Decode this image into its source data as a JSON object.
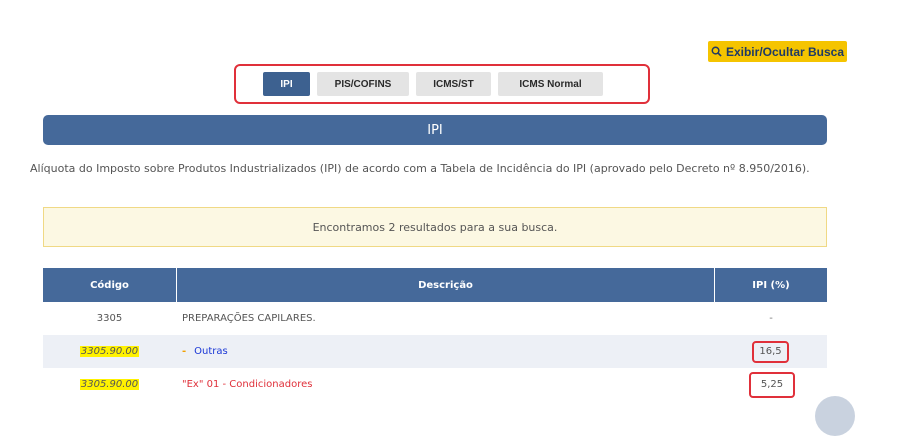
{
  "toolbar": {
    "toggle_search_label": "Exibir/Ocultar Busca"
  },
  "tabs": [
    {
      "label": "IPI",
      "active": true
    },
    {
      "label": "PIS/COFINS",
      "active": false
    },
    {
      "label": "ICMS/ST",
      "active": false
    },
    {
      "label": "ICMS Normal",
      "active": false
    }
  ],
  "section": {
    "title": "IPI",
    "description": "Alíquota do Imposto sobre Produtos Industrializados (IPI) de acordo com a Tabela de Incidência do IPI (aprovado pelo Decreto nº 8.950/2016)."
  },
  "alert": {
    "text": "Encontramos 2 resultados para a sua busca."
  },
  "table": {
    "headers": [
      "Código",
      "Descrição",
      "IPI (%)"
    ],
    "rows": [
      {
        "code": "3305",
        "dash": "",
        "description": "PREPARAÇÕES CAPILARES.",
        "ipi": "-"
      },
      {
        "code": "3305.90.00",
        "dash": "-",
        "description": "Outras",
        "ipi": "16,5"
      },
      {
        "code": "3305.90.00",
        "dash": "",
        "description": "\"Ex\" 01 - Condicionadores",
        "ipi": "5,25"
      }
    ]
  },
  "colors": {
    "primary": "#45699a",
    "accent": "#f5c400",
    "highlight": "#e0303a",
    "code_highlight": "#fff200",
    "link": "#1a37d6"
  },
  "icons": {
    "toggle_search": "search-icon"
  }
}
